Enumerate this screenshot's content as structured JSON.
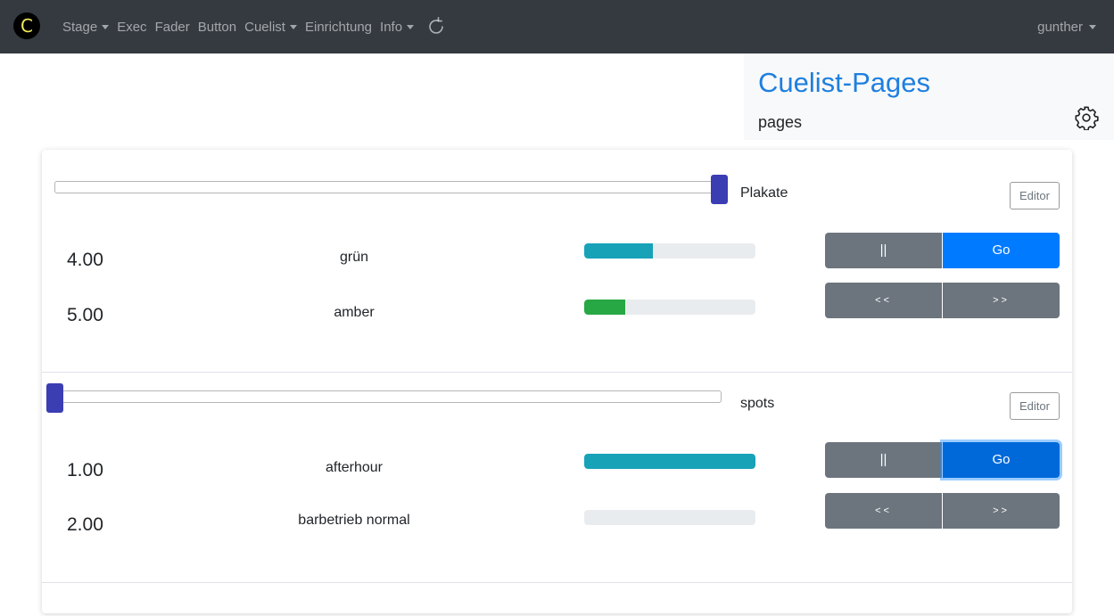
{
  "navbar": {
    "brand": "C",
    "items": [
      {
        "label": "Stage",
        "dropdown": true
      },
      {
        "label": "Exec",
        "dropdown": false
      },
      {
        "label": "Fader",
        "dropdown": false
      },
      {
        "label": "Button",
        "dropdown": false
      },
      {
        "label": "Cuelist",
        "dropdown": true
      },
      {
        "label": "Einrichtung",
        "dropdown": false
      },
      {
        "label": "Info",
        "dropdown": true
      }
    ],
    "reload_icon": "reload-icon",
    "user": "gunther"
  },
  "header": {
    "title": "Cuelist-Pages",
    "subtitle": "pages",
    "settings_icon": "gear-icon"
  },
  "cuelists": [
    {
      "name": "Plakate",
      "fader_level": 1.0,
      "editor_label": "Editor",
      "cues": [
        {
          "number": "4.00",
          "name": "grün",
          "progress": 0.4,
          "bar_color": "#17a2b8"
        },
        {
          "number": "5.00",
          "name": "amber",
          "progress": 0.24,
          "bar_color": "#28a745"
        }
      ],
      "pause_label": "||",
      "go_label": "Go",
      "prev_label": "<<",
      "next_label": ">>"
    },
    {
      "name": "spots",
      "fader_level": 0.0,
      "editor_label": "Editor",
      "cues": [
        {
          "number": "1.00",
          "name": "afterhour",
          "progress": 1.0,
          "bar_color": "#17a2b8"
        },
        {
          "number": "2.00",
          "name": "barbetrieb normal",
          "progress": 0.0,
          "bar_color": "#17a2b8"
        }
      ],
      "pause_label": "||",
      "go_label": "Go",
      "prev_label": "<<",
      "next_label": ">>"
    }
  ],
  "colors": {
    "navbar_bg": "#343a40",
    "accent": "#007bff",
    "title": "#1e7fe0",
    "thumb": "#3b3db3",
    "secondary": "#6c757d"
  }
}
